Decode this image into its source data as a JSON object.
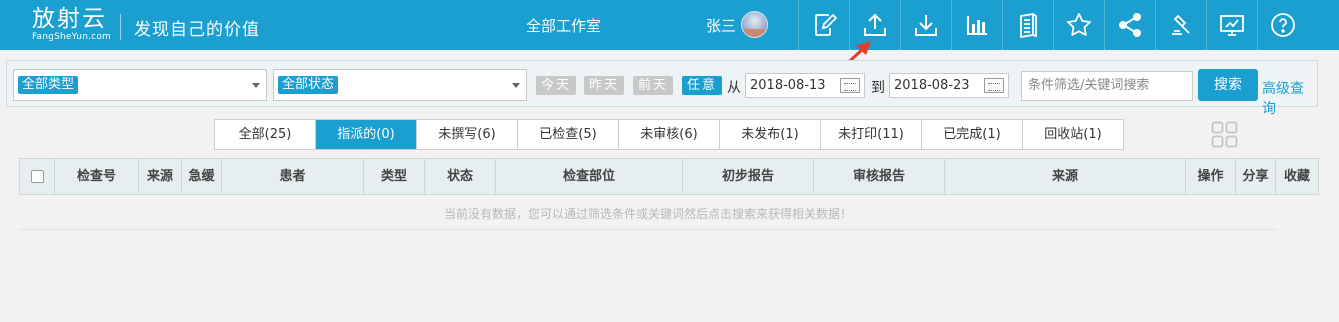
{
  "header": {
    "logo_main": "放射云",
    "logo_sub": "FangSheYun.com",
    "slogan": "发现自己的价值",
    "workspace": "全部工作室",
    "username": "张三",
    "icons": [
      "edit-icon",
      "upload-icon",
      "download-icon",
      "bar-chart-icon",
      "document-icon",
      "star-icon",
      "share-icon",
      "gavel-icon",
      "monitor-icon",
      "help-icon"
    ]
  },
  "filters": {
    "type_select": "全部类型",
    "status_select": "全部状态",
    "day_buttons": [
      "今天",
      "昨天",
      "前天",
      "任意"
    ],
    "from_label": "从",
    "date_from": "2018-08-13",
    "to_label": "到",
    "date_to": "2018-08-23",
    "search_placeholder": "条件筛选/关键词搜索",
    "search_button": "搜索",
    "advanced_link": "高级查询"
  },
  "tabs": [
    "全部(25)",
    "指派的(0)",
    "未撰写(6)",
    "已检查(5)",
    "未审核(6)",
    "未发布(1)",
    "未打印(11)",
    "已完成(1)",
    "回收站(1)"
  ],
  "active_tab": "指派的(0)",
  "table": {
    "columns": [
      "检查号",
      "来源",
      "急缓",
      "患者",
      "类型",
      "状态",
      "检查部位",
      "初步报告",
      "审核报告",
      "来源",
      "操作",
      "分享",
      "收藏"
    ],
    "empty_message": "当前没有数据，您可以通过筛选条件或关键词然后点击搜索来获得相关数据！"
  },
  "colors": {
    "brand": "#1a9fd0",
    "annotation_arrow": "#e8392b"
  }
}
